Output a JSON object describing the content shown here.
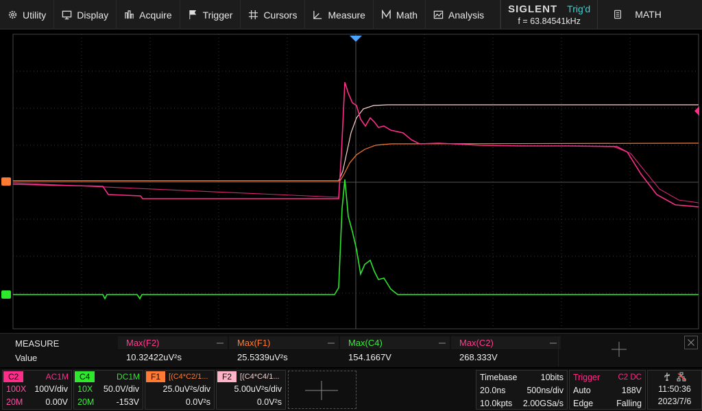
{
  "menu": {
    "utility": "Utility",
    "display": "Display",
    "acquire": "Acquire",
    "trigger": "Trigger",
    "cursors": "Cursors",
    "measure": "Measure",
    "math": "Math",
    "analysis": "Analysis"
  },
  "brand": {
    "logo": "SIGLENT",
    "status": "Trig'd",
    "frequency": "f = 63.84541kHz"
  },
  "math_button": "MATH",
  "measure": {
    "title": "MEASURE",
    "row_label": "Value",
    "items": [
      {
        "name": "Max(F2)",
        "value": "10.32422uV²s",
        "color": "#ff3d8e"
      },
      {
        "name": "Max(F1)",
        "value": "25.5339uV²s",
        "color": "#ff7d3a"
      },
      {
        "name": "Max(C4)",
        "value": "154.1667V",
        "color": "#3fe93f"
      },
      {
        "name": "Max(C2)",
        "value": "268.333V",
        "color": "#ff3d8e"
      }
    ]
  },
  "channels": {
    "c2": {
      "tag": "C2",
      "coupling": "AC1M",
      "probe": "100X",
      "scale": "100V/div",
      "bw": "20M",
      "offset": "0.00V"
    },
    "c4": {
      "tag": "C4",
      "coupling": "DC1M",
      "probe": "10X",
      "scale": "50.0V/div",
      "bw": "20M",
      "offset": "-153V"
    },
    "f1": {
      "tag": "F1",
      "expr": "[(C4*C2/1...",
      "scale": "25.0uV²s/div",
      "offset": "0.0V²s"
    },
    "f2": {
      "tag": "F2",
      "expr": "[(C4*C4/1...",
      "scale": "5.00uV²s/div",
      "offset": "0.0V²s"
    }
  },
  "timebase": {
    "label": "Timebase",
    "bits": "10bits",
    "delay": "20.0ns",
    "scale": "500ns/div",
    "points": "10.0kpts",
    "rate": "2.00GSa/s"
  },
  "trigger": {
    "label": "Trigger",
    "source": "C2 DC",
    "mode": "Auto",
    "level": "188V",
    "type": "Edge",
    "slope": "Falling"
  },
  "clock": {
    "time": "11:50:36",
    "date": "2023/7/6"
  },
  "colors": {
    "c2": "#ff2d8a",
    "c4": "#2ee82e",
    "f1": "#ff7a33",
    "f2": "#ffd6cc",
    "trig_status": "#35d7d7"
  },
  "icons": [
    "gear-icon",
    "monitor-icon",
    "acquire-icon",
    "flag-icon",
    "cursor-icon",
    "measure-icon",
    "math-icon",
    "analysis-icon",
    "document-icon",
    "usb-icon",
    "network-icon"
  ]
}
